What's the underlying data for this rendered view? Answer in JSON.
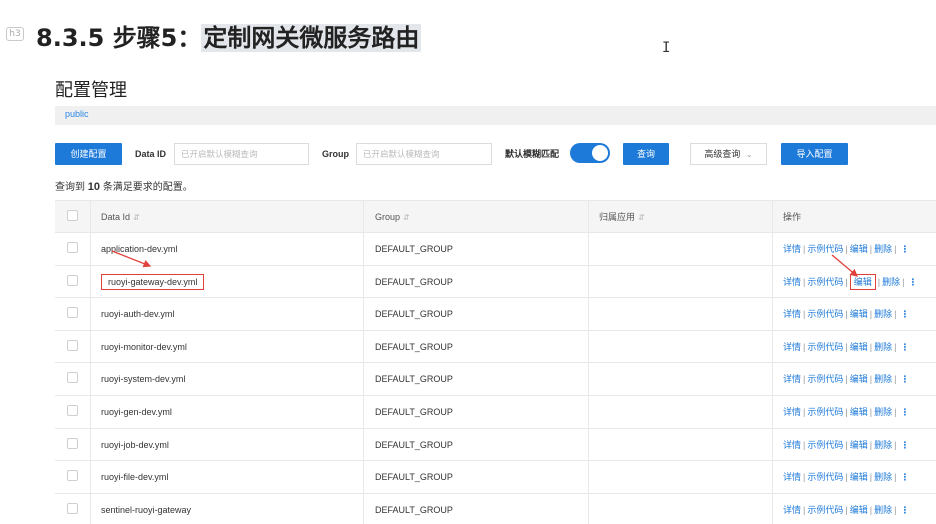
{
  "doc": {
    "heading_badge": "h3",
    "heading_prefix": "8.3.5 步骤5：",
    "heading_highlight": "定制网关微服务路由"
  },
  "config": {
    "title": "配置管理",
    "namespace_tab": "public",
    "create_button": "创建配置",
    "data_id_label": "Data ID",
    "data_id_placeholder": "已开启默认模糊查询",
    "group_label": "Group",
    "group_placeholder": "已开启默认模糊查询",
    "fuzzy_label": "默认模糊匹配",
    "fuzzy_enabled": true,
    "query_button": "查询",
    "advanced_button": "高级查询",
    "import_button": "导入配置",
    "result_prefix": "查询到",
    "result_count": "10",
    "result_suffix": "条满足要求的配置。"
  },
  "table": {
    "headers": {
      "data_id": "Data Id",
      "group": "Group",
      "app": "归属应用",
      "ops": "操作"
    },
    "ops": {
      "detail": "详情",
      "sample": "示例代码",
      "edit": "编辑",
      "delete": "删除",
      "sep": "|",
      "more": "⋮"
    },
    "rows": [
      {
        "data_id": "application-dev.yml",
        "group": "DEFAULT_GROUP",
        "app": ""
      },
      {
        "data_id": "ruoyi-gateway-dev.yml",
        "group": "DEFAULT_GROUP",
        "app": ""
      },
      {
        "data_id": "ruoyi-auth-dev.yml",
        "group": "DEFAULT_GROUP",
        "app": ""
      },
      {
        "data_id": "ruoyi-monitor-dev.yml",
        "group": "DEFAULT_GROUP",
        "app": ""
      },
      {
        "data_id": "ruoyi-system-dev.yml",
        "group": "DEFAULT_GROUP",
        "app": ""
      },
      {
        "data_id": "ruoyi-gen-dev.yml",
        "group": "DEFAULT_GROUP",
        "app": ""
      },
      {
        "data_id": "ruoyi-job-dev.yml",
        "group": "DEFAULT_GROUP",
        "app": ""
      },
      {
        "data_id": "ruoyi-file-dev.yml",
        "group": "DEFAULT_GROUP",
        "app": ""
      },
      {
        "data_id": "sentinel-ruoyi-gateway",
        "group": "DEFAULT_GROUP",
        "app": ""
      }
    ]
  },
  "colors": {
    "primary": "#1d7ad9",
    "annotation": "#e0413a"
  },
  "icons": {
    "heading_badge": "h3-badge-icon",
    "cursor": "ibeam-cursor-icon",
    "sort": "sort-icon",
    "dropdown": "chevron-down-icon"
  }
}
